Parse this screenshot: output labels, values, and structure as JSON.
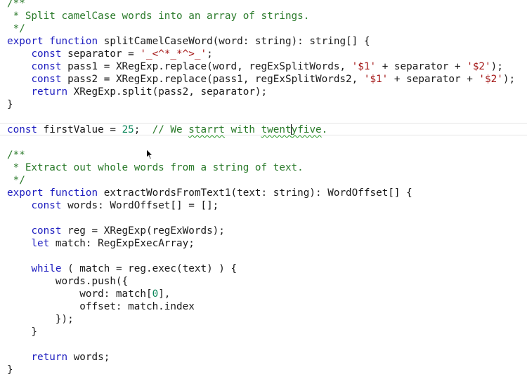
{
  "editor": {
    "lines": [
      [
        {
          "t": "/**",
          "c": "cm"
        }
      ],
      [
        {
          "t": " * Split camelCase words into an array of strings.",
          "c": "cm"
        }
      ],
      [
        {
          "t": " */",
          "c": "cm"
        }
      ],
      [
        {
          "t": "export",
          "c": "kw"
        },
        {
          "t": " ",
          "c": "id"
        },
        {
          "t": "function",
          "c": "kw"
        },
        {
          "t": " splitCamelCaseWord(word: string): string[] {",
          "c": "id"
        }
      ],
      [
        {
          "t": "    ",
          "c": "id"
        },
        {
          "t": "const",
          "c": "kw"
        },
        {
          "t": " separator = ",
          "c": "id"
        },
        {
          "t": "'_<^*_*^>_'",
          "c": "str"
        },
        {
          "t": ";",
          "c": "id"
        }
      ],
      [
        {
          "t": "    ",
          "c": "id"
        },
        {
          "t": "const",
          "c": "kw"
        },
        {
          "t": " pass1 = XRegExp.replace(word, regExSplitWords, ",
          "c": "id"
        },
        {
          "t": "'$1'",
          "c": "str"
        },
        {
          "t": " + separator + ",
          "c": "id"
        },
        {
          "t": "'$2'",
          "c": "str"
        },
        {
          "t": ");",
          "c": "id"
        }
      ],
      [
        {
          "t": "    ",
          "c": "id"
        },
        {
          "t": "const",
          "c": "kw"
        },
        {
          "t": " pass2 = XRegExp.replace(pass1, regExSplitWords2, ",
          "c": "id"
        },
        {
          "t": "'$1'",
          "c": "str"
        },
        {
          "t": " + separator + ",
          "c": "id"
        },
        {
          "t": "'$2'",
          "c": "str"
        },
        {
          "t": ");",
          "c": "id"
        }
      ],
      [
        {
          "t": "    ",
          "c": "kw"
        },
        {
          "t": "return",
          "c": "kw"
        },
        {
          "t": " XRegExp.split(pass2, separator);",
          "c": "id"
        }
      ],
      [
        {
          "t": "}",
          "c": "id"
        }
      ],
      [],
      [
        {
          "t": "const",
          "c": "kw"
        },
        {
          "t": " firstValue = ",
          "c": "id"
        },
        {
          "t": "25",
          "c": "num"
        },
        {
          "t": ";  ",
          "c": "id"
        },
        {
          "t": "// We ",
          "c": "cm"
        },
        {
          "t": "starrt",
          "c": "cm",
          "sq": true
        },
        {
          "t": " with ",
          "c": "cm"
        },
        {
          "t": "twent",
          "c": "cm",
          "sq": true,
          "caret": true
        },
        {
          "t": "yfive",
          "c": "cm",
          "sq": true
        },
        {
          "t": ".",
          "c": "cm"
        }
      ],
      [],
      [
        {
          "t": "/**",
          "c": "cm"
        }
      ],
      [
        {
          "t": " * Extract out whole words from a string of text.",
          "c": "cm"
        }
      ],
      [
        {
          "t": " */",
          "c": "cm"
        }
      ],
      [
        {
          "t": "export",
          "c": "kw"
        },
        {
          "t": " ",
          "c": "id"
        },
        {
          "t": "function",
          "c": "kw"
        },
        {
          "t": " extractWordsFromText1(text: string): WordOffset[] {",
          "c": "id"
        }
      ],
      [
        {
          "t": "    ",
          "c": "id"
        },
        {
          "t": "const",
          "c": "kw"
        },
        {
          "t": " words: WordOffset[] = [];",
          "c": "id"
        }
      ],
      [],
      [
        {
          "t": "    ",
          "c": "id"
        },
        {
          "t": "const",
          "c": "kw"
        },
        {
          "t": " reg = XRegExp(regExWords);",
          "c": "id"
        }
      ],
      [
        {
          "t": "    ",
          "c": "id"
        },
        {
          "t": "let",
          "c": "kw"
        },
        {
          "t": " match: RegExpExecArray;",
          "c": "id"
        }
      ],
      [],
      [
        {
          "t": "    ",
          "c": "id"
        },
        {
          "t": "while",
          "c": "kw"
        },
        {
          "t": " ( match = reg.exec(text) ) {",
          "c": "id"
        }
      ],
      [
        {
          "t": "        words.push({",
          "c": "id"
        }
      ],
      [
        {
          "t": "            word: match[",
          "c": "id"
        },
        {
          "t": "0",
          "c": "num"
        },
        {
          "t": "],",
          "c": "id"
        }
      ],
      [
        {
          "t": "            offset: match.index",
          "c": "id"
        }
      ],
      [
        {
          "t": "        });",
          "c": "id"
        }
      ],
      [
        {
          "t": "    }",
          "c": "id"
        }
      ],
      [],
      [
        {
          "t": "    ",
          "c": "id"
        },
        {
          "t": "return",
          "c": "kw"
        },
        {
          "t": " words;",
          "c": "id"
        }
      ],
      [
        {
          "t": "}",
          "c": "id"
        }
      ]
    ]
  },
  "colors": {
    "keyword": "#1d1dbf",
    "comment": "#2a7a2a",
    "string": "#a31515",
    "number": "#098658",
    "identifier": "#1a1a1a",
    "background": "#ffffff"
  },
  "cursor": {
    "icon": "arrow-pointer-icon"
  }
}
